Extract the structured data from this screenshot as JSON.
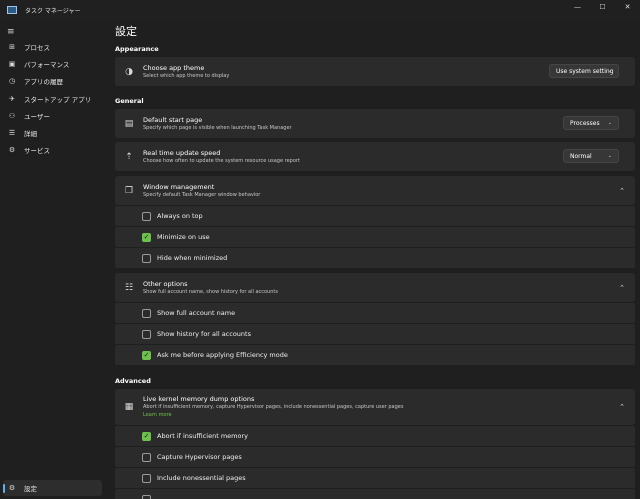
{
  "window": {
    "title": "タスク マネージャー",
    "min_glyph": "—",
    "max_glyph": "☐",
    "close_glyph": "✕",
    "icon": "task-manager-icon"
  },
  "sidebar": {
    "menu_glyph": "≡",
    "items": [
      {
        "label": "プロセス",
        "icon": "processes-icon",
        "glyph": "⊞"
      },
      {
        "label": "パフォーマンス",
        "icon": "performance-icon",
        "glyph": "▣"
      },
      {
        "label": "アプリの履歴",
        "icon": "app-history-icon",
        "glyph": "◷"
      },
      {
        "label": "スタートアップ アプリ",
        "icon": "startup-icon",
        "glyph": "✈"
      },
      {
        "label": "ユーザー",
        "icon": "users-icon",
        "glyph": "⚇"
      },
      {
        "label": "詳細",
        "icon": "details-icon",
        "glyph": "☰"
      },
      {
        "label": "サービス",
        "icon": "services-icon",
        "glyph": "⚙"
      }
    ],
    "settings": {
      "label": "設定",
      "icon": "gear-icon",
      "glyph": "⚙"
    }
  },
  "page": {
    "title": "設定"
  },
  "appearance": {
    "heading": "Appearance",
    "theme": {
      "title": "Choose app theme",
      "subtitle": "Select which app theme to display",
      "value": "Use system setting",
      "glyph": "◑"
    }
  },
  "general": {
    "heading": "General",
    "start_page": {
      "title": "Default start page",
      "subtitle": "Specify which page is visible when launching Task Manager",
      "value": "Processes",
      "glyph": "▤"
    },
    "update_speed": {
      "title": "Real time update speed",
      "subtitle": "Choose how often to update the system resource usage report",
      "value": "Normal",
      "glyph": "⇡"
    },
    "window_mgmt": {
      "title": "Window management",
      "subtitle": "Specify default Task Manager window behavior",
      "glyph": "❐",
      "options": [
        {
          "label": "Always on top",
          "checked": false
        },
        {
          "label": "Minimize on use",
          "checked": true
        },
        {
          "label": "Hide when minimized",
          "checked": false
        }
      ]
    },
    "other": {
      "title": "Other options",
      "subtitle": "Show full account name, show history for all accounts",
      "glyph": "☷",
      "options": [
        {
          "label": "Show full account name",
          "checked": false
        },
        {
          "label": "Show history for all accounts",
          "checked": false
        },
        {
          "label": "Ask me before applying Efficiency mode",
          "checked": true
        }
      ]
    }
  },
  "advanced": {
    "heading": "Advanced",
    "dump": {
      "title": "Live kernel memory dump options",
      "subtitle": "Abort if insufficient memory, capture Hypervisor pages, include nonessential pages, capture user pages",
      "link": "Learn more",
      "glyph": "▦",
      "options": [
        {
          "label": "Abort if insufficient memory",
          "checked": true
        },
        {
          "label": "Capture Hypervisor pages",
          "checked": false
        },
        {
          "label": "Include nonessential pages",
          "checked": false
        }
      ]
    }
  },
  "colors": {
    "accent": "#6cc24a",
    "nav_indicator": "#5fb2f2",
    "card": "#2b2b2b",
    "background": "#1f1f1f"
  },
  "glyphs": {
    "chevron_down": "⌄",
    "chevron_up": "⌃",
    "check": "✓"
  }
}
